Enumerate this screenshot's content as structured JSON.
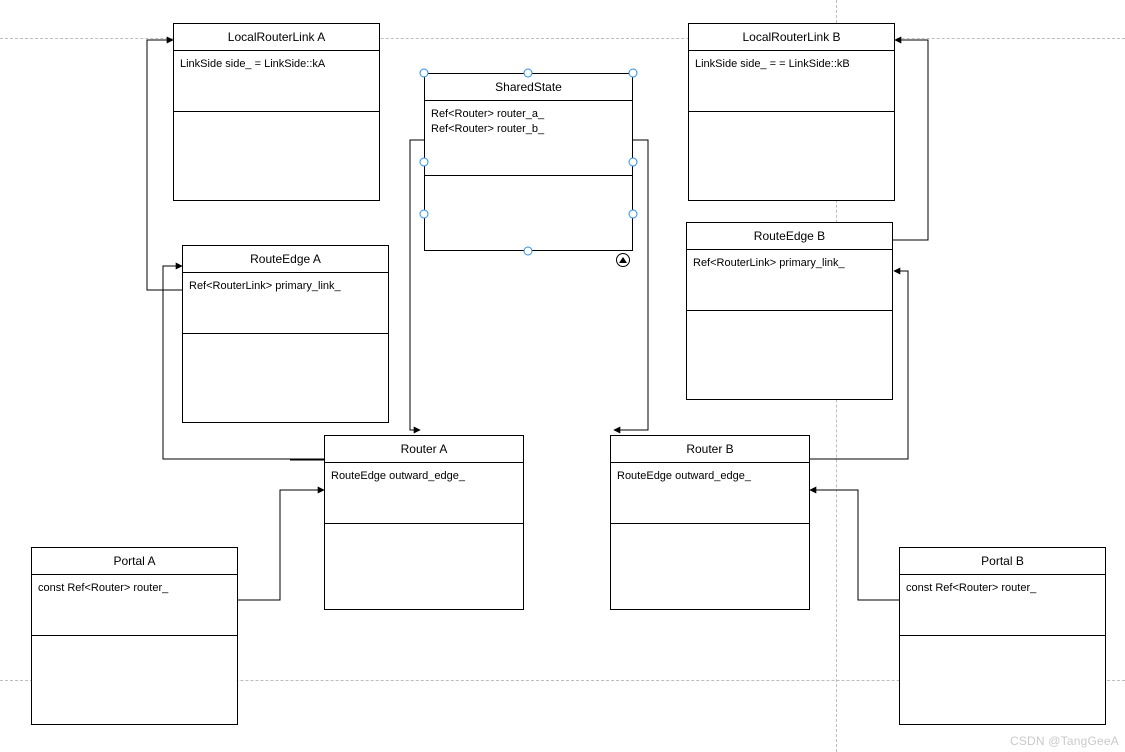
{
  "watermark": "CSDN @TangGeeA",
  "boxes": {
    "localA": {
      "title": "LocalRouterLink A",
      "attributes": [
        "LinkSide side_ = LinkSide::kA"
      ]
    },
    "localB": {
      "title": "LocalRouterLink B",
      "attributes": [
        "LinkSide side_ =  = LinkSide::kB"
      ]
    },
    "shared": {
      "title": "SharedState",
      "attributes": [
        "Ref<Router> router_a_",
        "Ref<Router> router_b_"
      ]
    },
    "routeEdgeA": {
      "title": "RouteEdge A",
      "attributes": [
        "Ref<RouterLink> primary_link_"
      ]
    },
    "routeEdgeB": {
      "title": "RouteEdge B",
      "attributes": [
        "Ref<RouterLink> primary_link_"
      ]
    },
    "routerA": {
      "title": "Router A",
      "attributes": [
        "RouteEdge outward_edge_"
      ]
    },
    "routerB": {
      "title": "Router B",
      "attributes": [
        "RouteEdge outward_edge_"
      ]
    },
    "portalA": {
      "title": "Portal A",
      "attributes": [
        "const Ref<Router> router_"
      ]
    },
    "portalB": {
      "title": "Portal B",
      "attributes": [
        "const Ref<Router> router_"
      ]
    }
  },
  "chart_data": {
    "type": "uml-class-diagram",
    "classes": [
      {
        "name": "LocalRouterLink A",
        "attributes": [
          "LinkSide side_ = LinkSide::kA"
        ]
      },
      {
        "name": "LocalRouterLink B",
        "attributes": [
          "LinkSide side_ =  = LinkSide::kB"
        ]
      },
      {
        "name": "SharedState",
        "attributes": [
          "Ref<Router> router_a_",
          "Ref<Router> router_b_"
        ],
        "selected": true
      },
      {
        "name": "RouteEdge A",
        "attributes": [
          "Ref<RouterLink> primary_link_"
        ]
      },
      {
        "name": "RouteEdge B",
        "attributes": [
          "Ref<RouterLink> primary_link_"
        ]
      },
      {
        "name": "Router A",
        "attributes": [
          "RouteEdge outward_edge_"
        ]
      },
      {
        "name": "Router B",
        "attributes": [
          "RouteEdge outward_edge_"
        ]
      },
      {
        "name": "Portal A",
        "attributes": [
          "const Ref<Router> router_"
        ]
      },
      {
        "name": "Portal B",
        "attributes": [
          "const Ref<Router> router_"
        ]
      }
    ],
    "edges": [
      {
        "from": "RouteEdge A",
        "to": "LocalRouterLink A",
        "kind": "arrow"
      },
      {
        "from": "RouteEdge B",
        "to": "LocalRouterLink B",
        "kind": "arrow"
      },
      {
        "from": "Router A",
        "to": "RouteEdge A",
        "kind": "arrow"
      },
      {
        "from": "Router B",
        "to": "RouteEdge B",
        "kind": "arrow"
      },
      {
        "from": "SharedState",
        "to": "Router A",
        "kind": "arrow"
      },
      {
        "from": "SharedState",
        "to": "Router B",
        "kind": "arrow"
      },
      {
        "from": "Portal A",
        "to": "Router A",
        "kind": "arrow"
      },
      {
        "from": "Portal B",
        "to": "Router B",
        "kind": "arrow"
      }
    ]
  }
}
